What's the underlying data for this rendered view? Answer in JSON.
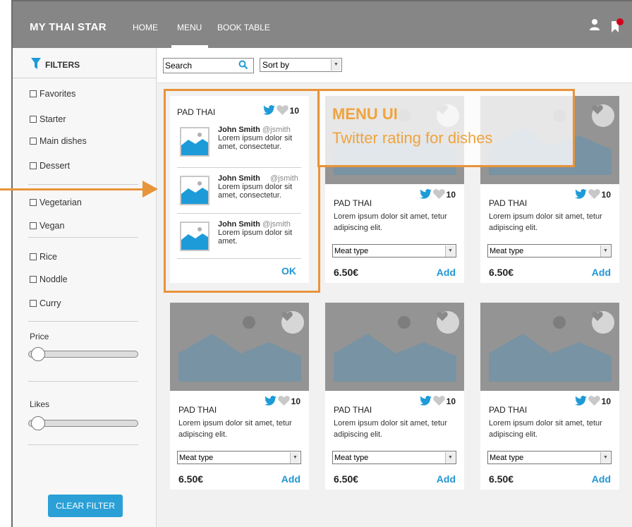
{
  "header": {
    "brand": "MY THAI STAR",
    "nav": {
      "home": "HOME",
      "menu": "MENU",
      "book_table": "BOOK TABLE"
    },
    "notification_color": "#d0021b"
  },
  "sidebar": {
    "title": "FILTERS",
    "groups": [
      [
        "Favorites",
        "Starter",
        "Main dishes",
        "Dessert"
      ],
      [
        "Vegetarian",
        "Vegan"
      ],
      [
        "Rice",
        "Noddle",
        "Curry"
      ]
    ],
    "price_label": "Price",
    "likes_label": "Likes",
    "clear_filter": "CLEAR FILTER"
  },
  "toolbar": {
    "search_value": "Search",
    "sort_label": "Sort by"
  },
  "expanded_card": {
    "name": "PAD THAI",
    "likes": "10",
    "tweets": [
      {
        "author": "John Smith",
        "handle": "@jsmith",
        "text": "Lorem ipsum dolor sit amet, consectetur."
      },
      {
        "author": "John Smith",
        "handle": "@jsmith",
        "text": "Lorem ipsum dolor sit amet, consectetur."
      },
      {
        "author": "John Smith",
        "handle": "@jsmith",
        "text": "Lorem ipsum dolor sit amet."
      }
    ],
    "ok_label": "OK"
  },
  "cards": [
    {
      "name": "PAD THAI",
      "likes": "10",
      "description": "Lorem ipsum dolor sit amet, tetur adipiscing elit.",
      "meat_type": "Meat type",
      "price": "6.50€",
      "add": "Add"
    },
    {
      "name": "PAD THAI",
      "likes": "10",
      "description": "Lorem ipsum dolor sit amet, tetur adipiscing elit.",
      "meat_type": "Meat type",
      "price": "6.50€",
      "add": "Add"
    },
    {
      "name": "PAD THAI",
      "likes": "10",
      "description": "Lorem ipsum dolor sit amet, tetur adipiscing elit.",
      "meat_type": "Meat type",
      "price": "6.50€",
      "add": "Add"
    },
    {
      "name": "PAD THAI",
      "likes": "10",
      "description": "Lorem ipsum dolor sit amet, tetur adipiscing elit.",
      "meat_type": "Meat type",
      "price": "6.50€",
      "add": "Add"
    },
    {
      "name": "PAD THAI",
      "likes": "10",
      "description": "Lorem ipsum dolor sit amet, tetur adipiscing elit.",
      "meat_type": "Meat type",
      "price": "6.50€",
      "add": "Add"
    }
  ],
  "annotation": {
    "title": "MENU UI",
    "subtitle": "Twitter rating for dishes",
    "color": "#e8943a"
  },
  "colors": {
    "header_bg": "#868686",
    "accent_blue": "#2196d3",
    "twitter_blue": "#1d9bd8"
  }
}
